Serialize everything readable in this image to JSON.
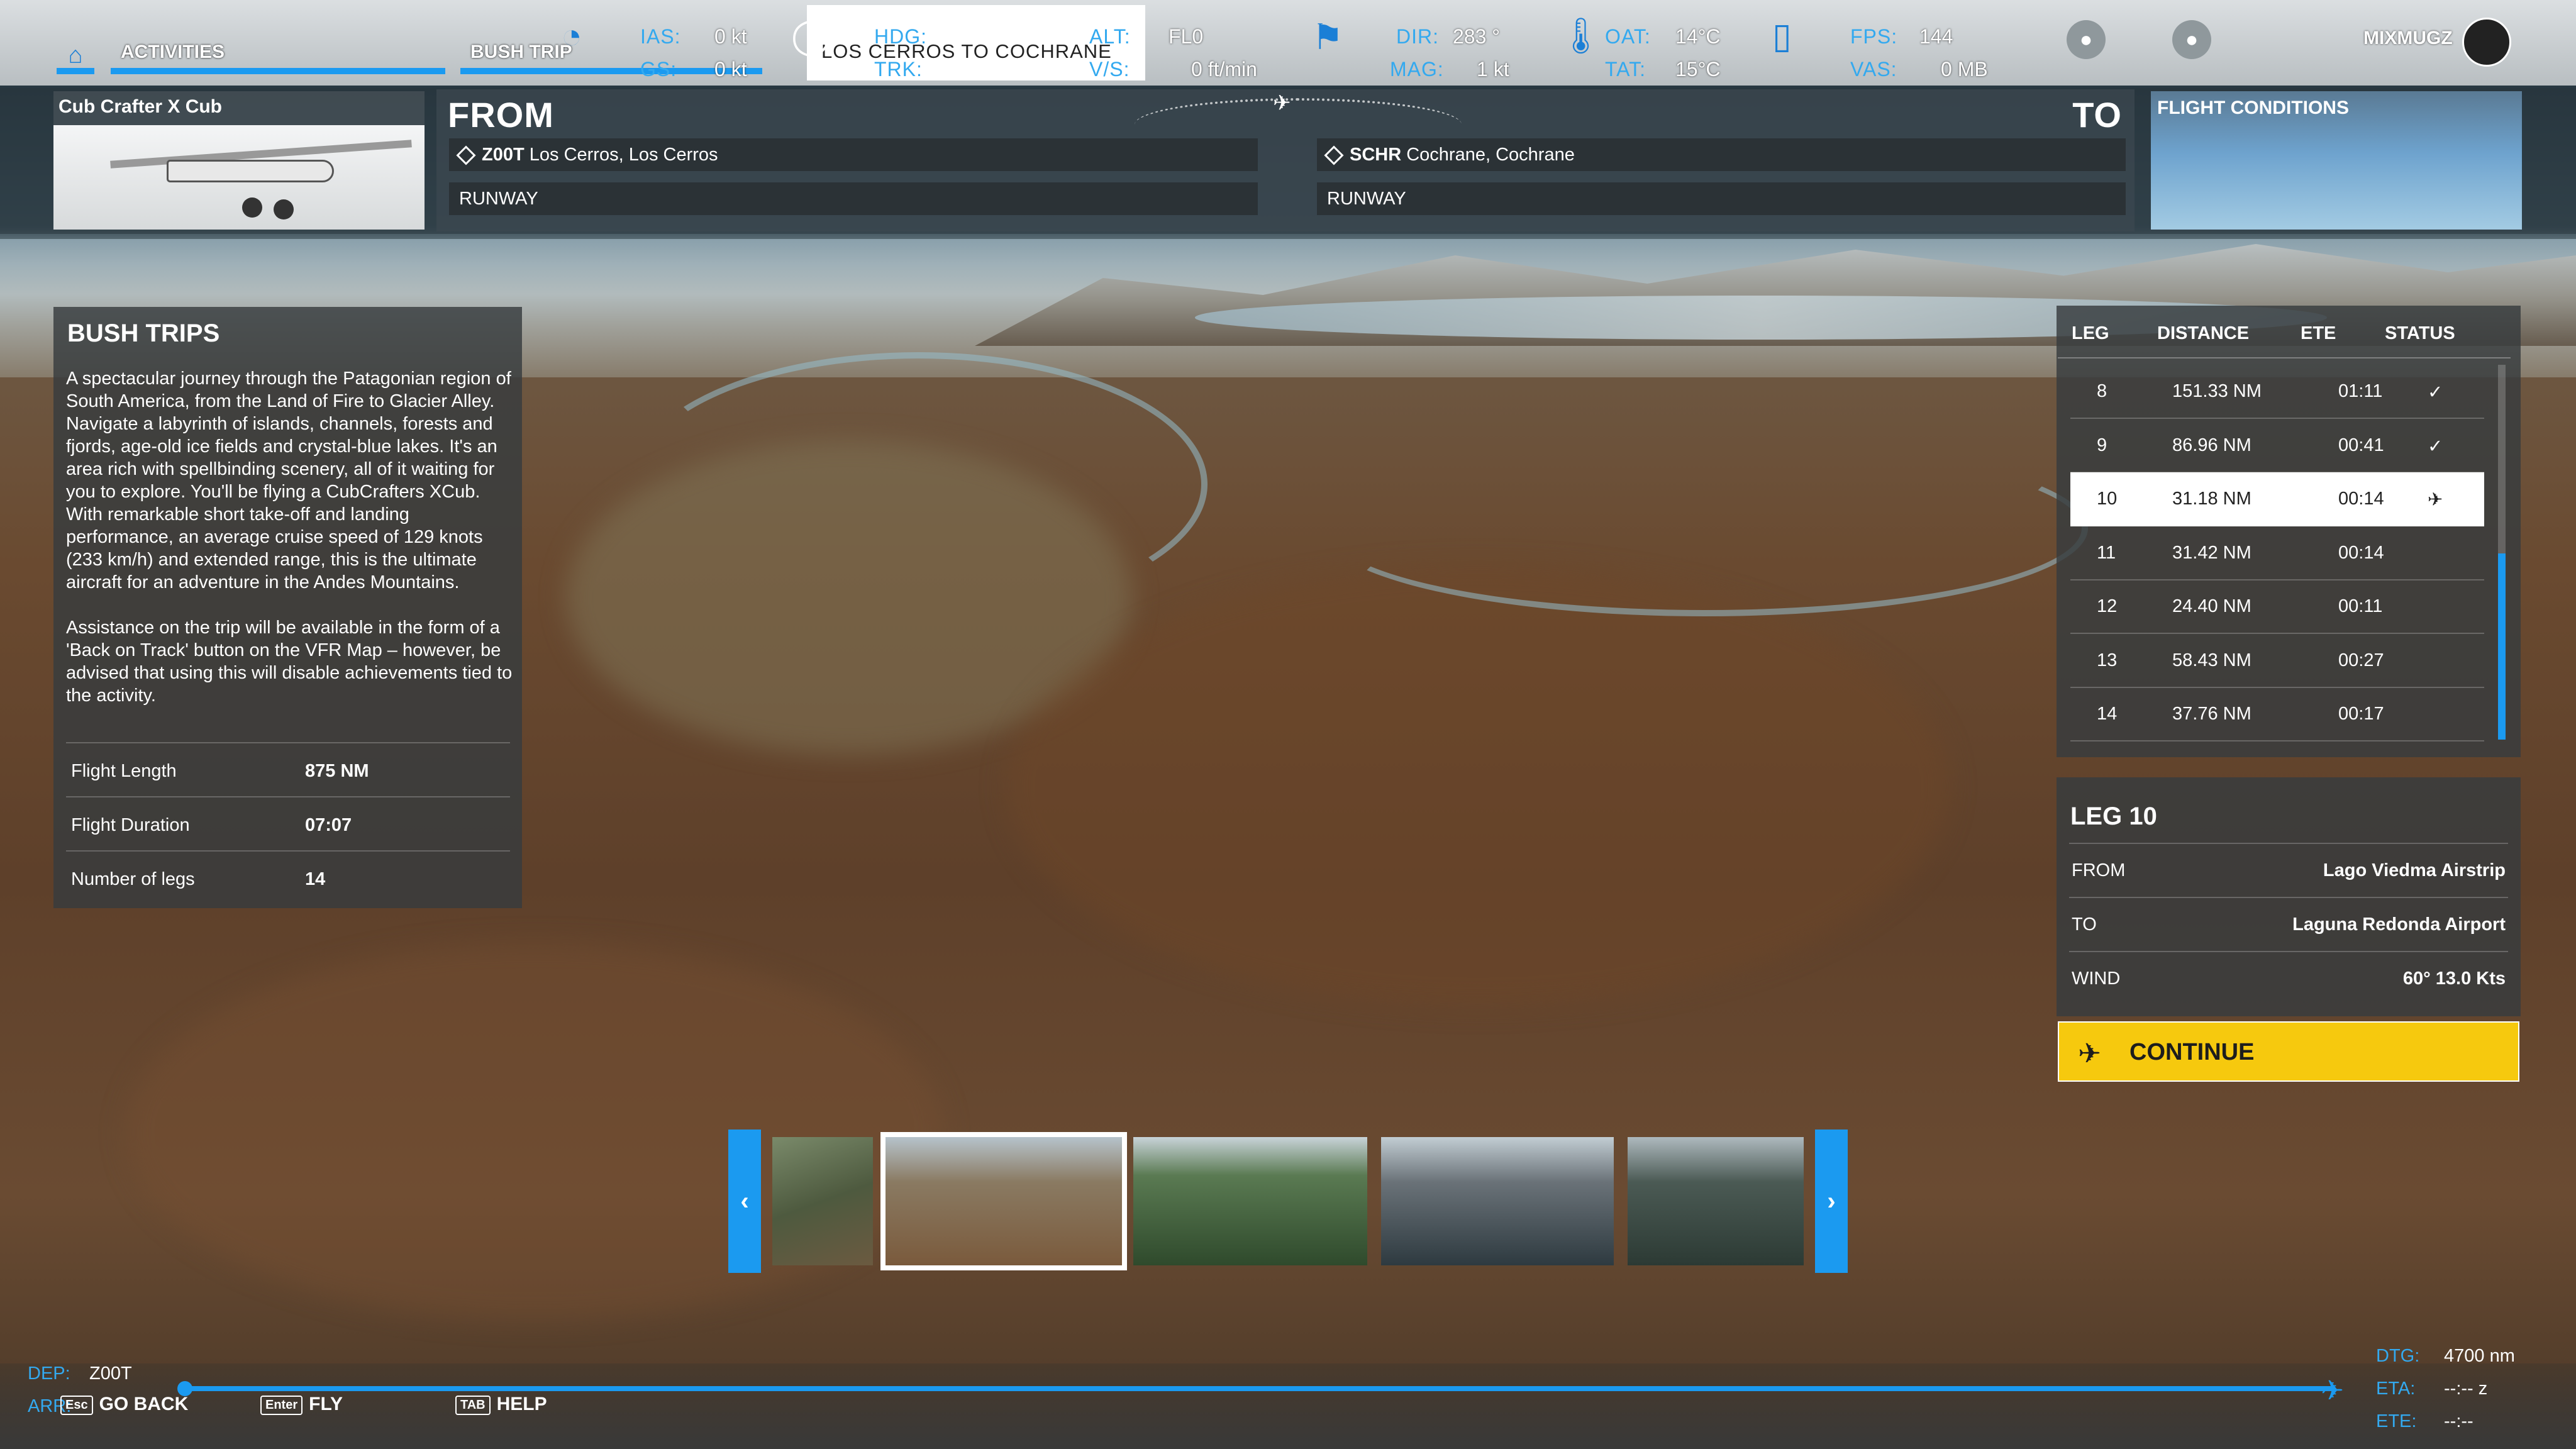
{
  "nav": {
    "home_icon": "home-icon",
    "activities": "ACTIVITIES",
    "bush_trip": "BUSH TRIP"
  },
  "hud": {
    "ias_label": "IAS:",
    "ias_value": "0 kt",
    "gs_label": "GS:",
    "gs_value": "0 kt",
    "hdg_label": "HDG:",
    "trk_label": "TRK:",
    "trk_value": "",
    "route_title": "LOS CERROS TO COCHRANE",
    "alt_label": "ALT:",
    "alt_value": "FL0",
    "vs_label": "V/S:",
    "vs_value": "0 ft/min",
    "dir_label": "DIR:",
    "dir_value": "283 °",
    "mag_label": "MAG:",
    "mag_value": "1 kt",
    "oat_label": "OAT:",
    "oat_value": "14°C",
    "tat_label": "TAT:",
    "tat_value": "15°C",
    "fps_label": "FPS:",
    "fps_value": "144",
    "vas_label": "VAS:",
    "vas_value": "0 MB"
  },
  "user": {
    "name": "MIXMUGZ"
  },
  "aircraft": {
    "name": "Cub Crafter X Cub"
  },
  "from": {
    "heading": "FROM",
    "code": "Z00T",
    "name": "Los Cerros, Los Cerros",
    "runway": "RUNWAY"
  },
  "to": {
    "heading": "TO",
    "code": "SCHR",
    "name": "Cochrane, Cochrane",
    "runway": "RUNWAY"
  },
  "flight_conditions": {
    "title": "FLIGHT CONDITIONS"
  },
  "bush_trips": {
    "title": "BUSH TRIPS",
    "paragraph1": "A spectacular journey through the Patagonian region of South America, from the Land of Fire to Glacier Alley. Navigate a labyrinth of islands, channels, forests and fjords, age-old ice fields and crystal-blue lakes. It's an area rich with spellbinding scenery, all of it waiting for you to explore. You'll be flying a CubCrafters XCub. With remarkable short take-off and landing performance, an average cruise speed of 129 knots (233 km/h) and extended range, this is the ultimate aircraft for an adventure in the Andes Mountains.",
    "paragraph2": "Assistance on the trip will be available in the form of a 'Back on Track' button on the VFR Map – however, be advised that using this will disable achievements tied to the activity.",
    "stats": [
      {
        "label": "Flight Length",
        "value": "875 NM"
      },
      {
        "label": "Flight Duration",
        "value": "07:07"
      },
      {
        "label": "Number of legs",
        "value": "14"
      }
    ]
  },
  "legs": {
    "headers": {
      "leg": "LEG",
      "distance": "DISTANCE",
      "ete": "ETE",
      "status": "STATUS"
    },
    "rows": [
      {
        "leg": "8",
        "distance": "151.33 NM",
        "ete": "01:11",
        "status": "✓"
      },
      {
        "leg": "9",
        "distance": "86.96 NM",
        "ete": "00:41",
        "status": "✓"
      },
      {
        "leg": "10",
        "distance": "31.18 NM",
        "ete": "00:14",
        "status": "✈"
      },
      {
        "leg": "11",
        "distance": "31.42 NM",
        "ete": "00:14",
        "status": ""
      },
      {
        "leg": "12",
        "distance": "24.40 NM",
        "ete": "00:11",
        "status": ""
      },
      {
        "leg": "13",
        "distance": "58.43 NM",
        "ete": "00:27",
        "status": ""
      },
      {
        "leg": "14",
        "distance": "37.76 NM",
        "ete": "00:17",
        "status": ""
      }
    ]
  },
  "leg_detail": {
    "title": "LEG 10",
    "from_label": "FROM",
    "from_value": "Lago Viedma Airstrip",
    "to_label": "TO",
    "to_value": "Laguna Redonda Airport",
    "wind_label": "WIND",
    "wind_value": "60° 13.0 Kts"
  },
  "continue": {
    "label": "CONTINUE"
  },
  "gallery": {
    "prev": "‹",
    "next": "›"
  },
  "bottom": {
    "dep_label": "DEP:",
    "dep_value": "Z00T",
    "arr_label": "ARR:",
    "back_key": "Esc",
    "back_label": "GO BACK",
    "fly_key": "Enter",
    "fly_label": "FLY",
    "help_key": "TAB",
    "help_label": "HELP",
    "dtg_label": "DTG:",
    "dtg_value": "4700 nm",
    "eta_label": "ETA:",
    "eta_value": "--:-- z",
    "ete_label": "ETE:",
    "ete_value": "--:--"
  },
  "colors": {
    "accent": "#1b9af0",
    "continue": "#f6c90e"
  }
}
